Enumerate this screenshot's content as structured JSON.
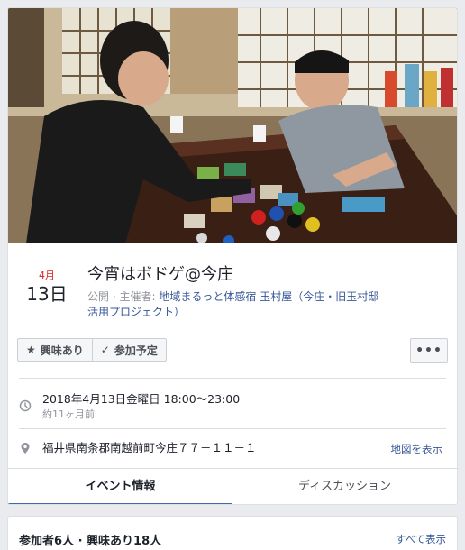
{
  "event": {
    "month": "4月",
    "day": "13日",
    "title": "今宵はボドゲ@今庄",
    "visibility": "公開",
    "separator": "·",
    "host_label": "主催者:",
    "host_name_line1": "地域まるっと体感宿 玉村屋（今庄・旧玉村邸",
    "host_name_line2": "活用プロジェクト）"
  },
  "actions": {
    "interested_label": "興味あり",
    "going_label": "参加予定",
    "more_label": "•••"
  },
  "details": {
    "datetime": "2018年4月13日金曜日 18:00〜23:00",
    "relative": "約11ヶ月前",
    "address": "福井県南条郡南越前町今庄７７－１１－１",
    "map_link": "地図を表示"
  },
  "tabs": [
    {
      "label": "イベント情報",
      "active": true
    },
    {
      "label": "ディスカッション",
      "active": false
    }
  ],
  "attendance": {
    "summary": "参加者6人 · 興味あり18人",
    "see_all": "すべて表示"
  },
  "colors": {
    "accent": "#4267b2",
    "link": "#385898",
    "month_red": "#e02020"
  },
  "icons": {
    "star": "star-icon",
    "check": "check-icon",
    "clock": "clock-icon",
    "pin": "location-pin-icon"
  }
}
